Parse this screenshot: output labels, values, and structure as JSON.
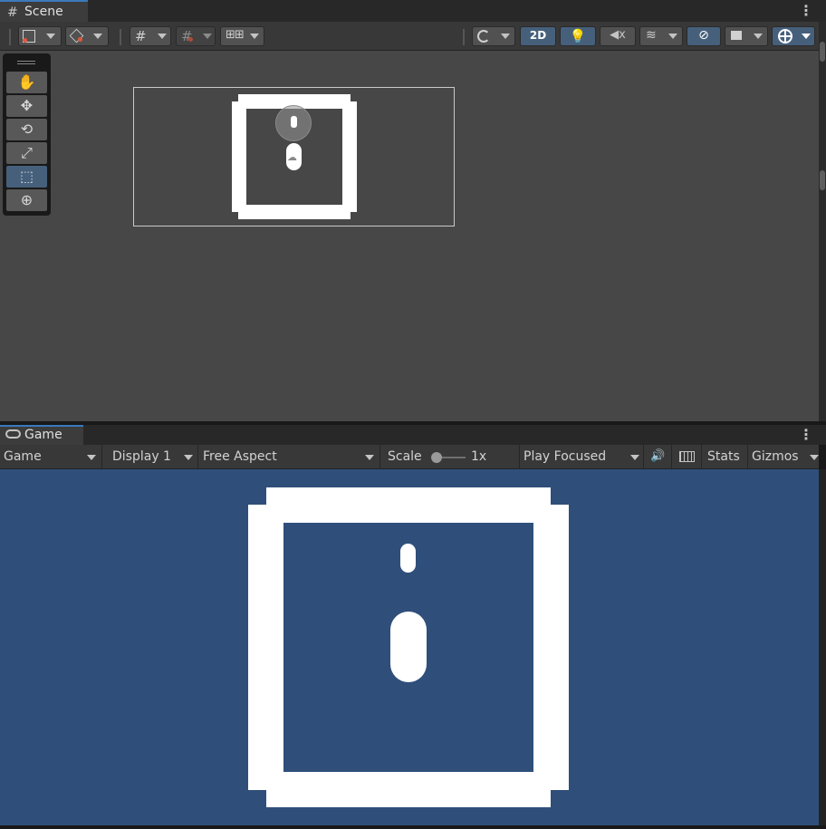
{
  "scene_panel": {
    "tab_label": "Scene",
    "tab_icon": "grid-icon",
    "toolbar": {
      "toggle_2d_label": "2D",
      "toggle_2d_active": true,
      "lighting_active": true,
      "gizmos_active": true
    },
    "tools": [
      {
        "name": "hand-tool",
        "glyph": "✋"
      },
      {
        "name": "move-tool",
        "glyph": "✥"
      },
      {
        "name": "rotate-tool",
        "glyph": "⟲"
      },
      {
        "name": "scale-tool",
        "glyph": "⤢"
      },
      {
        "name": "rect-tool",
        "glyph": "⬚",
        "active": true
      },
      {
        "name": "transform-tool",
        "glyph": "⊕"
      }
    ]
  },
  "game_panel": {
    "tab_label": "Game",
    "toolbar": {
      "mode_label": "Game",
      "display_label": "Display 1",
      "aspect_label": "Free Aspect",
      "scale_label": "Scale",
      "scale_value": "1x",
      "play_mode_label": "Play Focused",
      "stats_label": "Stats",
      "gizmos_label": "Gizmos"
    }
  },
  "colors": {
    "accent": "#3a79bb",
    "active_button": "#46607c",
    "game_background": "#2f4f7a",
    "scene_background": "#474747"
  }
}
